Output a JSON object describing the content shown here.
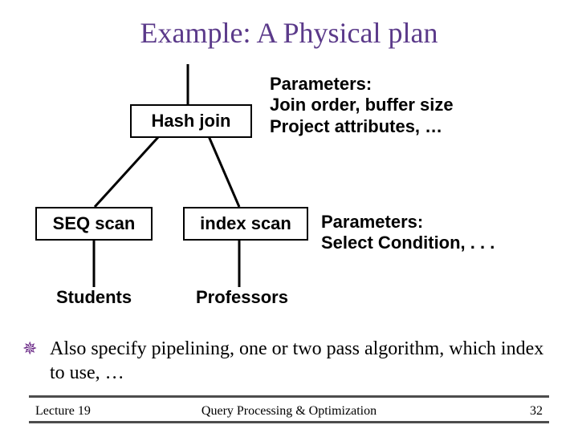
{
  "title": "Example: A Physical plan",
  "nodes": {
    "hashjoin": "Hash join",
    "seqscan": "SEQ scan",
    "indexscan": "index scan"
  },
  "leaves": {
    "students": "Students",
    "professors": "Professors"
  },
  "params": {
    "top": {
      "line1": "Parameters:",
      "line2": "Join order, buffer size",
      "line3": "Project attributes, …"
    },
    "right": {
      "line1": "Parameters:",
      "line2": "Select Condition, . . ."
    }
  },
  "bullet": "Also specify pipelining, one or two pass algorithm, which index to use, …",
  "footer": {
    "left": "Lecture 19",
    "center": "Query Processing & Optimization",
    "pageno": "32"
  },
  "colors": {
    "title": "#5b3a8a",
    "bullet_glyph": "#6b2a87",
    "rule": "#4d4d4d"
  }
}
